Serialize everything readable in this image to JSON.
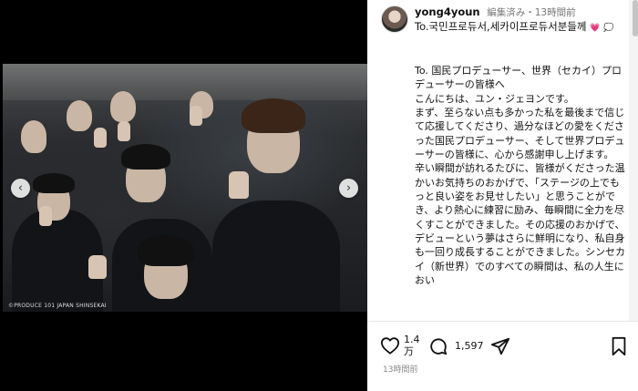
{
  "post": {
    "username": "yong4youn",
    "edited": "編集済み",
    "separator": "・",
    "time": "13時間前",
    "to_line": "To.국민프로듀서,세카이프로듀서분들께",
    "body": [
      "To. 国民プロデューサー、世界（セカイ）プロデューサーの皆様へ",
      "こんにちは、ユン・ジェヨンです。",
      "まず、至らない点も多かった私を最後まで信じて応援してくださり、過分なほどの愛をくださった国民プロデューサー、そして世界プロデューサーの皆様に、心から感謝申し上げます。",
      "辛い瞬間が訪れるたびに、皆様がくださった温かいお気持ちのおかげで、「ステージの上でもっと良い姿をお見せしたい」と思うことができ、より熱心に練習に励み、毎瞬間に全力を尽くすことができました。その応援のおかげで、デビューという夢はさらに鮮明になり、私自身も一回り成長することができました。シンセカイ（新世界）でのすべての瞬間は、私の人生におい"
    ]
  },
  "photo": {
    "caption": "©PRODUCE 101 JAPAN SHINSEKAI"
  },
  "actions": {
    "like_count_line1": "1.4",
    "like_count_line2": "万",
    "comment_count": "1,597",
    "time_bottom": "13時間前"
  },
  "icons": {
    "prev": "chevron-left-icon",
    "next": "chevron-right-icon",
    "heart": "heart-icon",
    "comment": "comment-icon",
    "share": "share-icon",
    "save": "bookmark-icon"
  }
}
